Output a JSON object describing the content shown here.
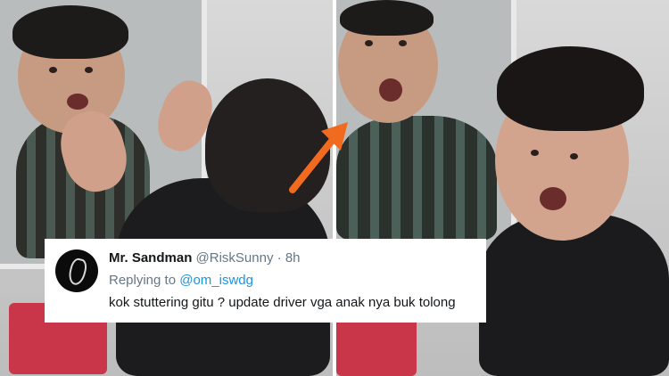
{
  "tweet": {
    "display_name": "Mr. Sandman",
    "handle": "@RiskSunny",
    "separator": "·",
    "time": "8h",
    "replying_prefix": "Replying to",
    "replying_to": "@om_iswdg",
    "text": "kok stuttering gitu ? update driver vga anak nya buk tolong"
  },
  "colors": {
    "arrow": "#f06a1f",
    "mention": "#1b95e0",
    "name": "#14171a",
    "meta": "#657786"
  },
  "icons": {
    "arrow": "orange-arrow-icon",
    "avatar": "avatar"
  }
}
